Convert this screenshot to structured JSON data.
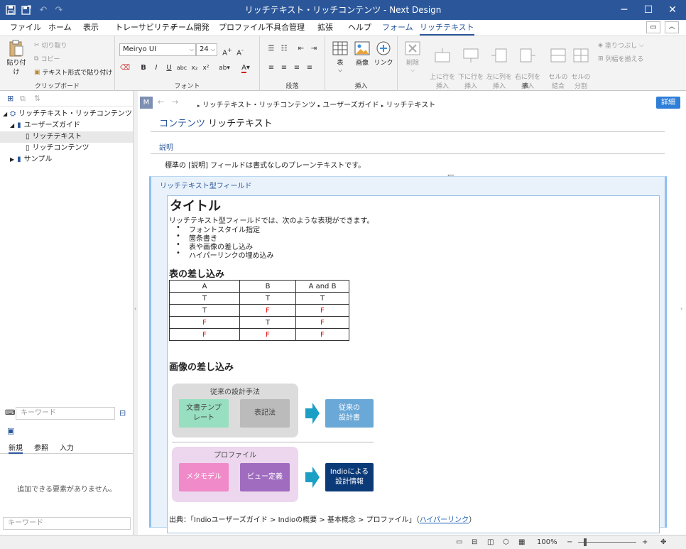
{
  "window": {
    "title": "リッチテキスト・リッチコンテンツ - Next Design"
  },
  "menu": {
    "tabs": [
      "ファイル",
      "ホーム",
      "表示",
      "トレーサビリティ",
      "チーム開発",
      "プロファイル",
      "不具合管理",
      "拡張",
      "ヘルプ",
      "フォーム",
      "リッチテキスト"
    ]
  },
  "ribbon": {
    "clipboard": {
      "label": "クリップボード",
      "paste": "貼り付け",
      "cut": "切り取り",
      "copy": "コピー",
      "paste_text": "テキスト形式で貼り付け"
    },
    "font": {
      "label": "フォント",
      "family": "Meiryo UI",
      "size": "24"
    },
    "paragraph": {
      "label": "段落"
    },
    "insert": {
      "label": "挿入",
      "table": "表",
      "image": "画像",
      "link": "リンク"
    },
    "table": {
      "label": "表",
      "delete": "削除",
      "row_above": "上に行を\n挿入",
      "row_below": "下に行を\n挿入",
      "col_left": "左に列を\n挿入",
      "col_right": "右に列を\n挿入",
      "merge": "セルの\n結合",
      "split": "セルの\n分割",
      "fill": "塗りつぶし",
      "equal_width": "列幅を揃える"
    }
  },
  "left": {
    "tree": [
      {
        "label": "リッチテキスト・リッチコンテンツ"
      },
      {
        "label": "ユーザーズガイド"
      },
      {
        "label": "リッチテキスト"
      },
      {
        "label": "リッチコンテンツ"
      },
      {
        "label": "サンプル"
      }
    ],
    "search_placeholder": "キーワード",
    "bottom_tabs": [
      "新規",
      "参照",
      "入力"
    ],
    "empty_message": "追加できる要素がありません。",
    "bottom_search_placeholder": "キーワード"
  },
  "main": {
    "nav_badge": "M",
    "breadcrumb": [
      "リッチテキスト・リッチコンテンツ",
      "ユーザーズガイド",
      "リッチテキスト"
    ],
    "detail_button": "詳細",
    "content_prefix": "コンテンツ",
    "content_title": "リッチテキスト",
    "desc_label": "説明",
    "desc_text": "標準の [説明] フィールドは書式なしのプレーンテキストです。",
    "rich_field_label": "リッチテキスト型フィールド",
    "rich": {
      "title": "タイトル",
      "intro": "リッチテキスト型フィールドでは、次のような表現ができます。",
      "bullets": [
        "フォントスタイル指定",
        "箇条書き",
        "表や画像の差し込み",
        "ハイパーリンクの埋め込み"
      ],
      "table_heading": "表の差し込み",
      "table_header": [
        "A",
        "B",
        "A  and B"
      ],
      "table_rows": [
        [
          "T",
          "T",
          "T"
        ],
        [
          "T",
          "F",
          "F"
        ],
        [
          "F",
          "T",
          "F"
        ],
        [
          "F",
          "F",
          "F"
        ]
      ],
      "image_heading": "画像の差し込み",
      "diagram": {
        "group1_title": "従来の設計手法",
        "box_doc": "文書テンプ\nレート",
        "box_notation": "表記法",
        "result1": "従来の\n設計書",
        "group2_title": "プロファイル",
        "box_meta": "メタモデル",
        "box_view": "ビュー定義",
        "result2": "Indioによる\n設計情報"
      },
      "source_text": "出典：「Indioユーザーズガイド > Indioの概要 > 基本概念 > プロファイル」（",
      "source_link": "ハイパーリンク",
      "source_end": "）"
    }
  },
  "status": {
    "zoom": "100%"
  },
  "colors": {
    "accent": "#2b579a",
    "link": "#1a5fb4",
    "red": "#e00000"
  }
}
